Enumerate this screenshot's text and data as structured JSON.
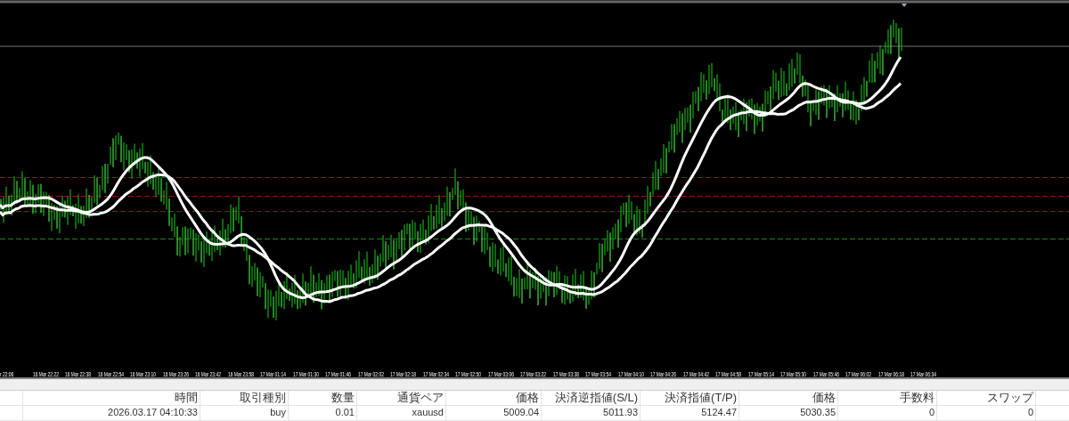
{
  "time_axis": {
    "labels": [
      "r 22:06",
      "16 Mar 22:22",
      "16 Mar 22:38",
      "16 Mar 22:54",
      "16 Mar 23:10",
      "16 Mar 23:26",
      "16 Mar 23:42",
      "16 Mar 23:58",
      "17 Mar 01:14",
      "17 Mar 01:30",
      "17 Mar 01:46",
      "17 Mar 02:02",
      "17 Mar 02:18",
      "17 Mar 02:34",
      "17 Mar 02:50",
      "17 Mar 03:06",
      "17 Mar 03:22",
      "17 Mar 03:38",
      "17 Mar 03:54",
      "17 Mar 04:10",
      "17 Mar 04:26",
      "17 Mar 04:42",
      "17 Mar 04:58",
      "17 Mar 05:14",
      "17 Mar 05:30",
      "17 Mar 05:46",
      "17 Mar 06:02",
      "17 Mar 06:18",
      "17 Mar 06:34"
    ]
  },
  "table": {
    "columns": [
      "時間",
      "取引種別",
      "数量",
      "通貨ペア",
      "価格",
      "決済逆指値(S/L)",
      "決済指値(T/P)",
      "価格",
      "手数料",
      "スワップ"
    ],
    "rows": [
      [
        "2026.03.17 04:10:33",
        "buy",
        "0.01",
        "xauusd",
        "5009.04",
        "5011.93",
        "5124.47",
        "5030.35",
        "0",
        "0"
      ]
    ]
  }
}
